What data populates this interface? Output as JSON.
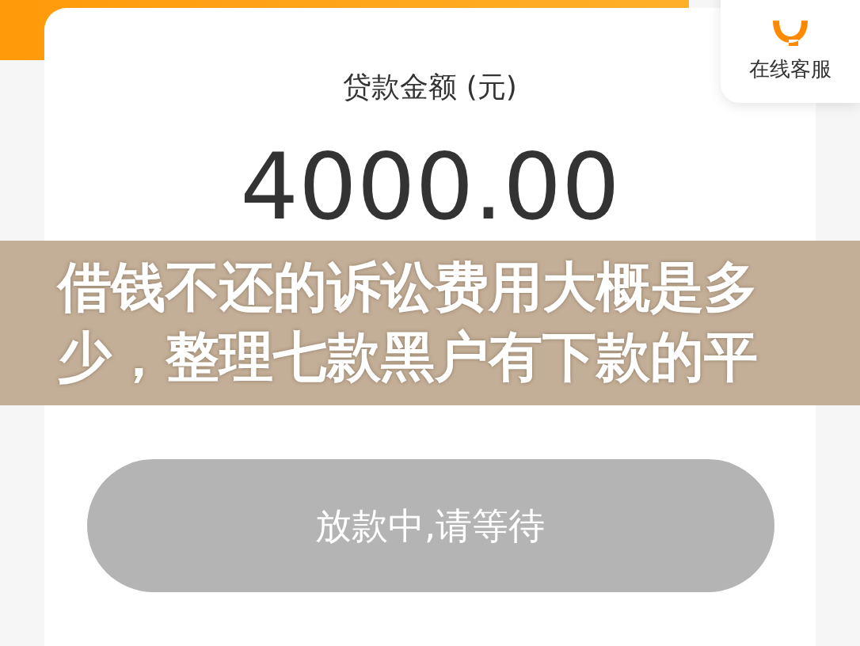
{
  "customer_service": {
    "label": "在线客服"
  },
  "loan": {
    "label": "贷款金额 (元)",
    "amount": "4000.00"
  },
  "action_button": {
    "label": "放款中,请等待",
    "disabled": true
  },
  "caption_banner": {
    "text": "借钱不还的诉讼费用大概是多少，整理七款黑户有下款的平"
  }
}
